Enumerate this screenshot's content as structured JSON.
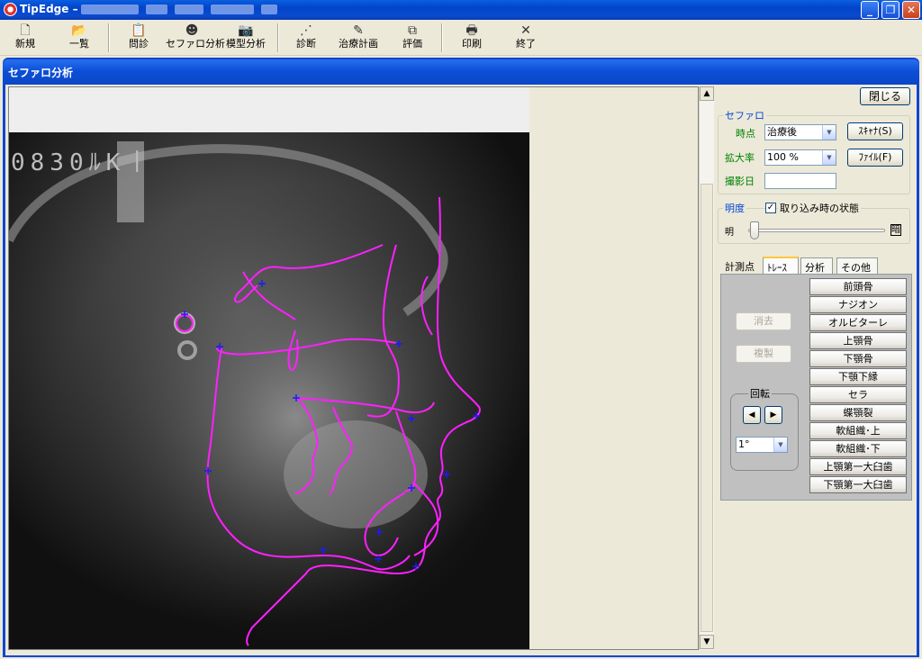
{
  "window": {
    "title": "TipEdge  –"
  },
  "toolbar": {
    "items": [
      {
        "label": "新規",
        "icon": "new-document-icon"
      },
      {
        "label": "一覧",
        "icon": "open-folder-icon"
      },
      {
        "label": "問診",
        "icon": "clipboard-icon"
      },
      {
        "label": "セファロ分析",
        "icon": "head-profile-icon"
      },
      {
        "label": "模型分析",
        "icon": "camera-model-icon"
      },
      {
        "label": "診断",
        "icon": "tree-diagram-icon"
      },
      {
        "label": "治療計画",
        "icon": "pencil-curve-icon"
      },
      {
        "label": "評価",
        "icon": "compare-icon"
      },
      {
        "label": "印刷",
        "icon": "printer-icon"
      },
      {
        "label": "終了",
        "icon": "close-x-icon"
      }
    ]
  },
  "child_window": {
    "title": "セファロ分析"
  },
  "xray": {
    "film_text": "0830ﾙK丨"
  },
  "panel": {
    "close_label": "閉じる",
    "cephalo": {
      "legend": "セファロ",
      "timepoint_label": "時点",
      "timepoint_value": "治療後",
      "scan_label": "ｽｷｬﾅ(S)",
      "zoom_label": "拡大率",
      "zoom_value": "100 %",
      "file_label": "ﾌｧｲﾙ(F)",
      "date_label": "撮影日",
      "date_value": ""
    },
    "brightness": {
      "legend": "明度",
      "checkbox_label": "取り込み時の状態",
      "checked": true,
      "bright_label": "明",
      "dark_label": "暗"
    },
    "tabs": [
      {
        "label": "計測点",
        "active": false
      },
      {
        "label": "ﾄﾚｰｽ",
        "active": true
      },
      {
        "label": "分析",
        "active": false
      },
      {
        "label": "その他",
        "active": false
      }
    ],
    "trace": {
      "delete_label": "消去",
      "copy_label": "複製",
      "rotate_legend": "回転",
      "rotate_left": "◀",
      "rotate_right": "▶",
      "angle_value": "1°",
      "structures": [
        "前頭骨",
        "ナジオン",
        "オルビターレ",
        "上顎骨",
        "下顎骨",
        "下顎下縁",
        "セラ",
        "蝶顎裂",
        "軟組織･上",
        "軟組織･下",
        "上顎第一大臼歯",
        "下顎第一大臼歯"
      ]
    }
  },
  "colors": {
    "trace": "#ff20ff",
    "landmark": "#1a1aff",
    "titlebar": "#0a4bd0"
  }
}
